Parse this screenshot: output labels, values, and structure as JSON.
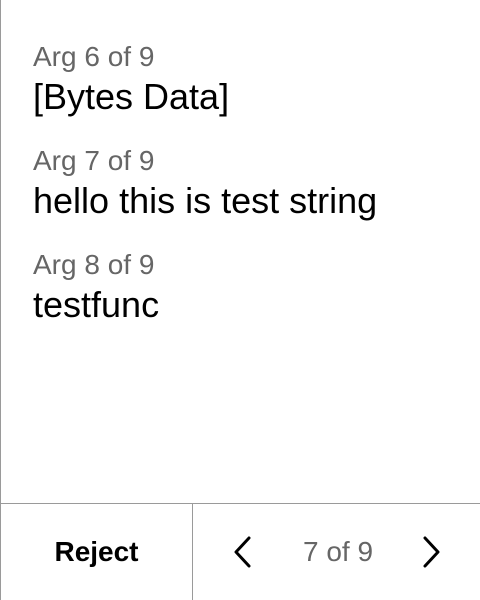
{
  "args": [
    {
      "label": "Arg 6 of 9",
      "value": "[Bytes Data]"
    },
    {
      "label": "Arg 7 of 9",
      "value": "hello this is test string"
    },
    {
      "label": "Arg 8 of 9",
      "value": "testfunc"
    }
  ],
  "footer": {
    "reject_label": "Reject",
    "page_indicator": "7 of 9",
    "prev_icon": "chevron-left",
    "next_icon": "chevron-right"
  },
  "colors": {
    "label": "#666666",
    "value": "#000000",
    "divider": "#9a9a9a",
    "background": "#ffffff"
  }
}
